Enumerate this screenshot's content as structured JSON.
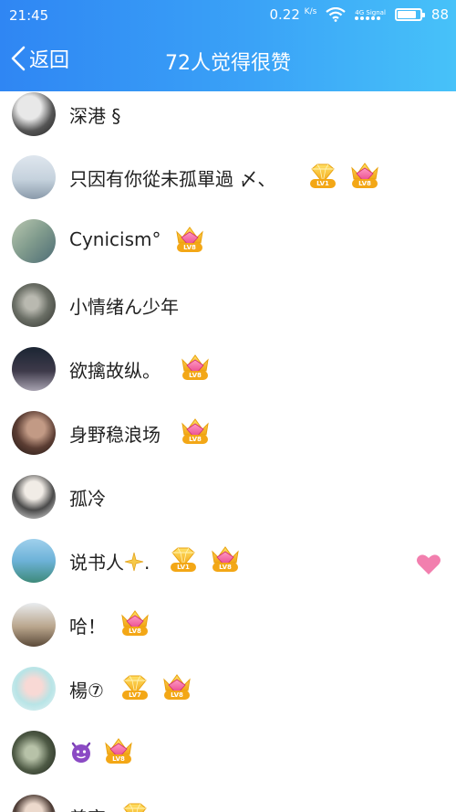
{
  "status_bar": {
    "time": "21:45",
    "speed": "0.22",
    "speed_unit": "K/s",
    "network": "4G Signal",
    "battery": "88"
  },
  "nav": {
    "back_label": "返回",
    "title": "72人觉得很赞"
  },
  "badges": {
    "lv1": "LV1",
    "lv7": "LV7",
    "lv8": "LV8"
  },
  "rows": [
    {
      "name": "深港 §"
    },
    {
      "name": "只因有你從未孤單過 〆、"
    },
    {
      "name": "Cynicism°"
    },
    {
      "name": "小情绪ん少年"
    },
    {
      "name": "欲擒故纵。"
    },
    {
      "name": "身野稳浪场"
    },
    {
      "name": "孤冷"
    },
    {
      "name": "说书人",
      "suffix": "."
    },
    {
      "name": "哈！"
    },
    {
      "name": "楊⑦"
    },
    {
      "name": ""
    },
    {
      "name": "善恋"
    }
  ],
  "colors": {
    "header_start": "#2f86f3",
    "header_end": "#47c2f9",
    "heart": "#f27fae"
  }
}
